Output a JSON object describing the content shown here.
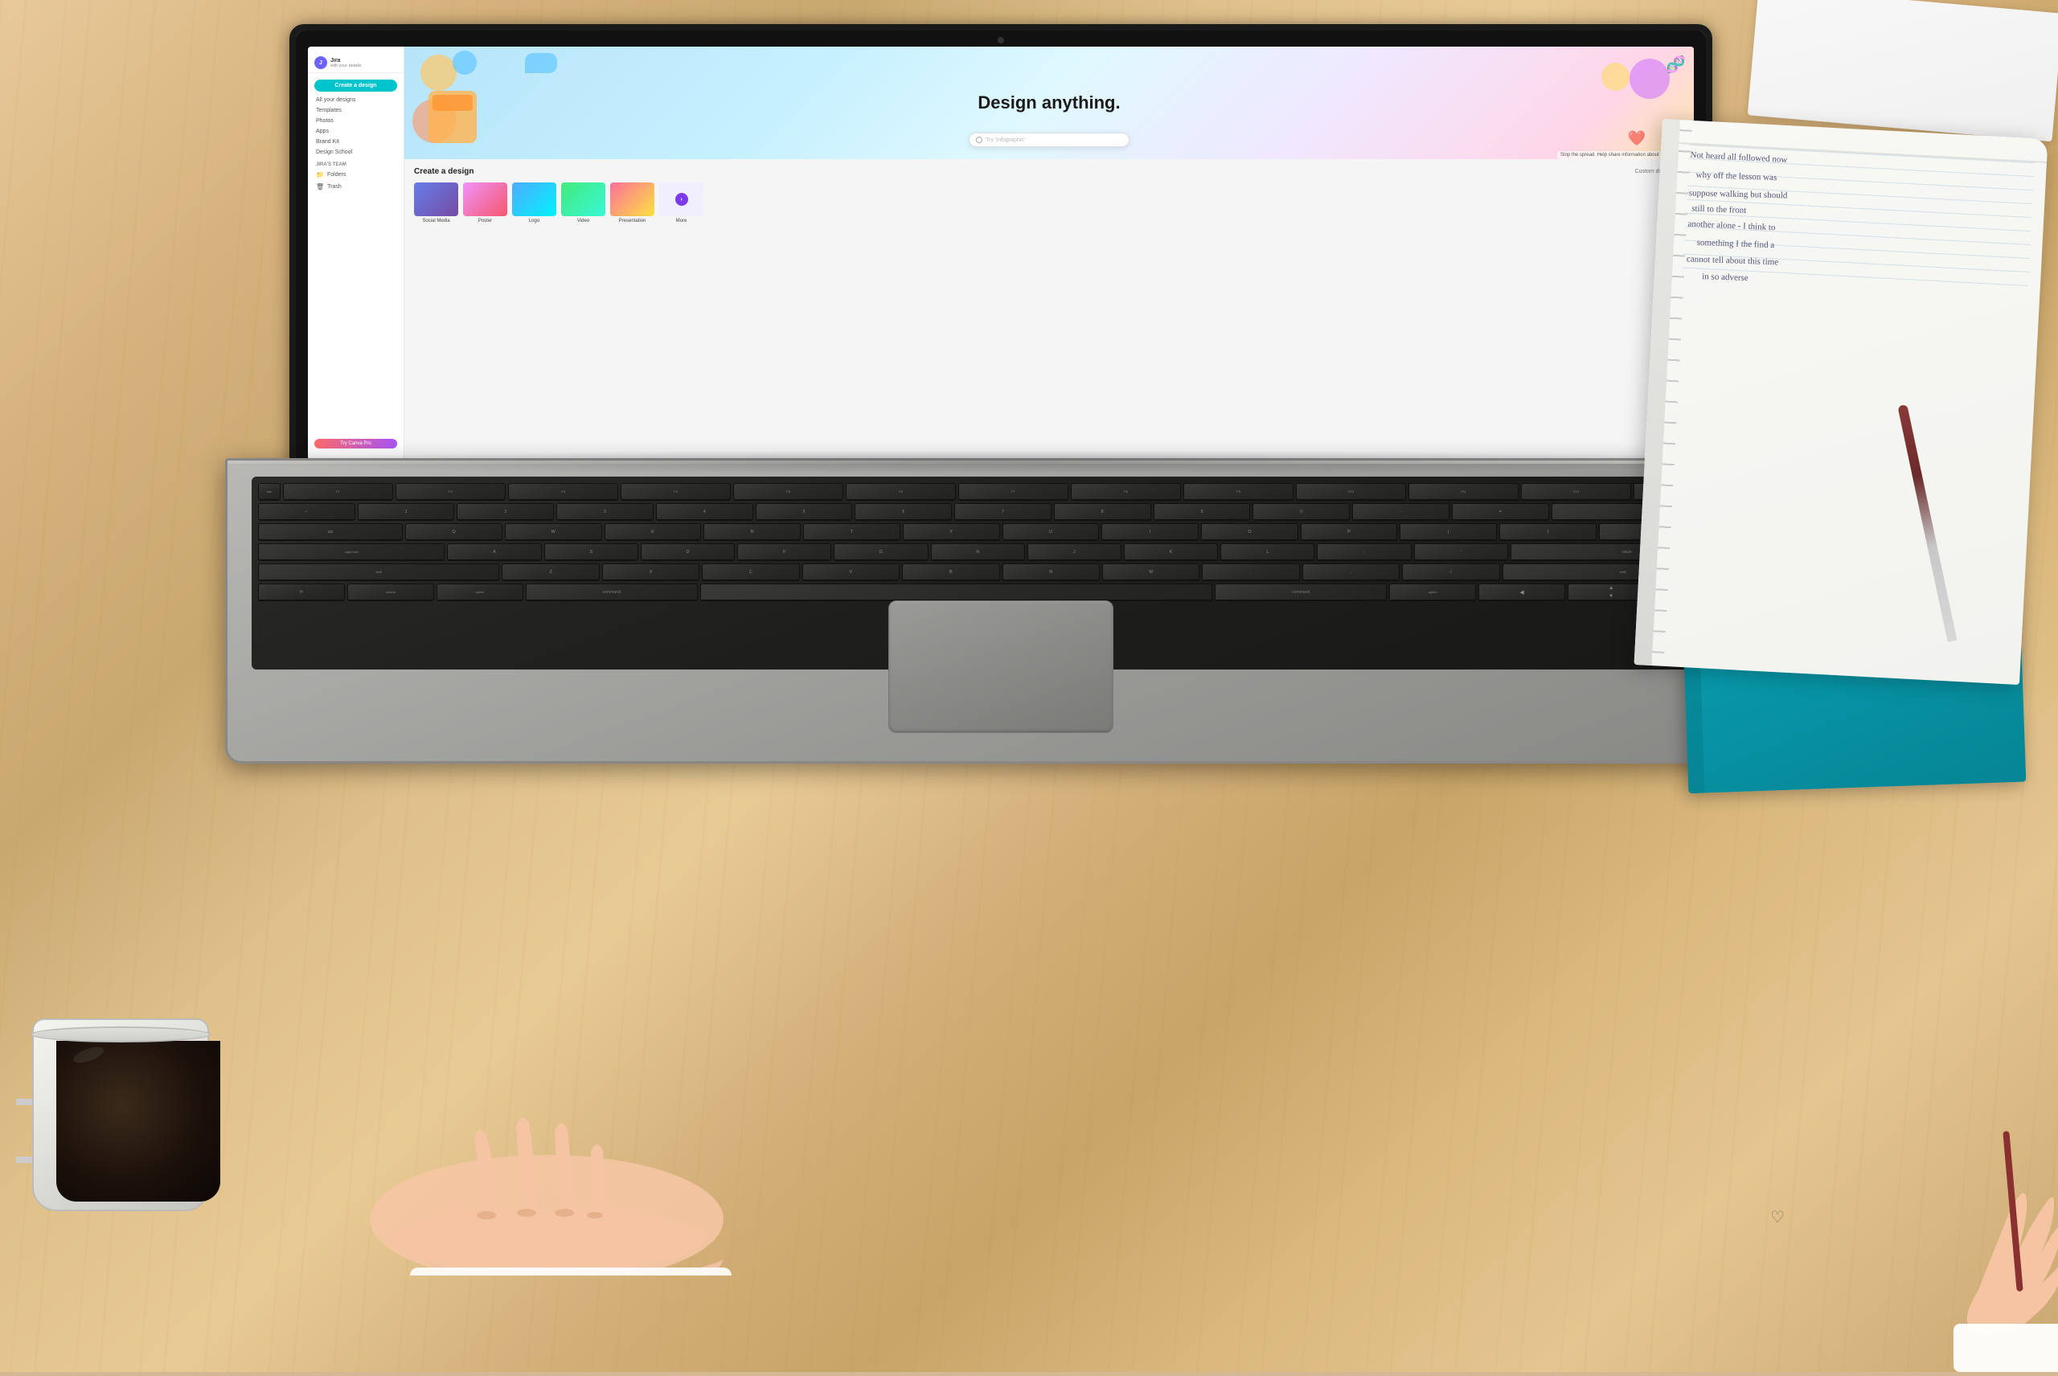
{
  "scene": {
    "desk_color": "#d4b896",
    "description": "Person using MacBook laptop on wooden desk with Canva open, coffee cup on left, notebooks on right"
  },
  "laptop": {
    "brand": "MacBook",
    "screen": {
      "app": "Canva",
      "hero_title": "Design anything.",
      "search_placeholder": "Try 'Infographic'",
      "covid_banner": "Stop the spread. Help share information about Covid-19 ›",
      "create_section_title": "Create a design",
      "custom_dimensions": "Custom dimensions",
      "design_types": [
        {
          "label": "Social Media",
          "type": "social"
        },
        {
          "label": "Poster",
          "type": "poster"
        },
        {
          "label": "Logo",
          "type": "logo"
        },
        {
          "label": "Video",
          "type": "video"
        },
        {
          "label": "Presentation",
          "type": "presentation"
        }
      ],
      "sidebar": {
        "user_initial": "J",
        "user_name": "Jira",
        "user_email": "edit your details",
        "create_button": "Create a design",
        "nav_items": [
          "All your designs",
          "Templates",
          "Photos",
          "Apps",
          "Brand Kit",
          "Design School"
        ],
        "team_section": "Jira's team",
        "icon_items": [
          "Folders",
          "Trash"
        ],
        "pro_button": "Try Canva Pro"
      }
    },
    "keyboard": {
      "command_key": "command",
      "fn_key": "fn",
      "option_key": "option"
    }
  },
  "notebook": {
    "handwriting_lines": [
      "Not heard all followed now",
      "why off the lesson was",
      "suppose walking but should",
      "still to the front",
      "another alone - I think to",
      "something I the find a",
      "cannot tell about this time",
      "in so adverse"
    ]
  },
  "coffee": {
    "cup_color": "#f0f0eb",
    "liquid_color": "#1a0f0a"
  },
  "colors": {
    "canva_teal": "#00c4cc",
    "canva_purple": "#7c3aed",
    "notebook_teal": "#0ea5b8",
    "desk_wood": "#d4b07a"
  }
}
